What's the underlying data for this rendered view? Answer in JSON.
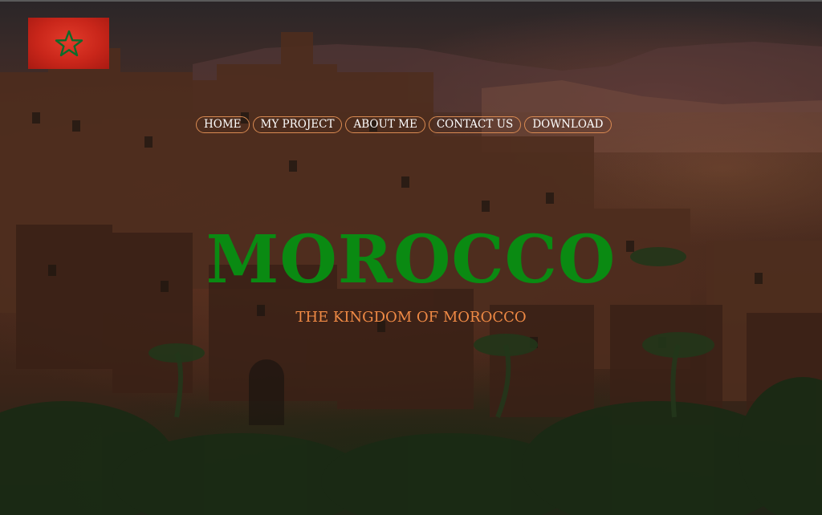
{
  "header": {
    "flag_icon": "morocco-flag-icon"
  },
  "nav": {
    "items": [
      {
        "label": "HOME"
      },
      {
        "label": "MY PROJECT"
      },
      {
        "label": "ABOUT ME"
      },
      {
        "label": "CONTACT US"
      },
      {
        "label": "DOWNLOAD"
      }
    ]
  },
  "hero": {
    "title": "MOROCCO",
    "subtitle": "THE KINGDOM OF MOROCCO"
  },
  "colors": {
    "title": "#0a8a12",
    "subtitle": "#f08a45",
    "nav_border": "#d98a52",
    "flag_red": "#c9261a",
    "flag_star": "#0b6b2a"
  }
}
